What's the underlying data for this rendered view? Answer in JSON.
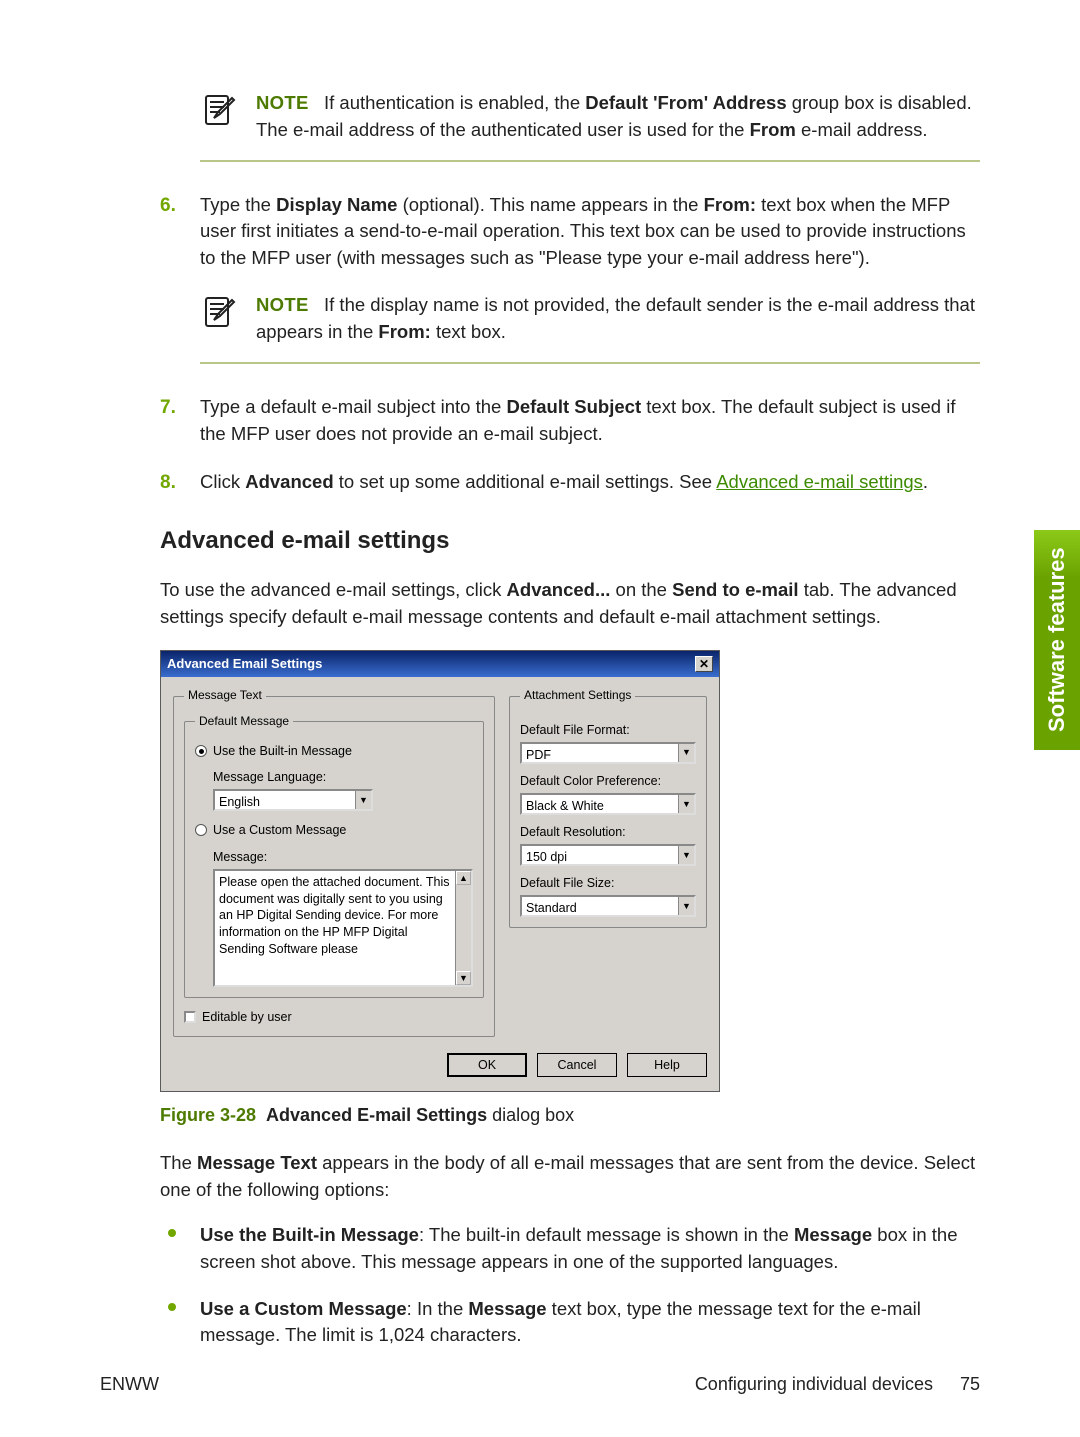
{
  "notes": {
    "label": "NOTE",
    "note1_a": "If authentication is enabled, the ",
    "note1_b": "Default 'From' Address",
    "note1_c": " group box is disabled. The e-mail address of the authenticated user is used for the ",
    "note1_d": "From",
    "note1_e": " e-mail address.",
    "note2_a": "If the display name is not provided, the default sender is the e-mail address that appears in the ",
    "note2_b": "From:",
    "note2_c": " text box."
  },
  "steps": {
    "s6": {
      "num": "6.",
      "a": "Type the ",
      "b": "Display Name",
      "c": " (optional). This name appears in the ",
      "d": "From:",
      "e": " text box when the MFP user first initiates a send-to-e-mail operation. This text box can be used to provide instructions to the MFP user (with messages such as \"Please type your e-mail address here\")."
    },
    "s7": {
      "num": "7.",
      "a": "Type a default e-mail subject into the ",
      "b": "Default Subject",
      "c": " text box. The default subject is used if the MFP user does not provide an e-mail subject."
    },
    "s8": {
      "num": "8.",
      "a": "Click ",
      "b": "Advanced",
      "c": " to set up some additional e-mail settings. See ",
      "link": "Advanced e-mail settings",
      "d": "."
    }
  },
  "section": {
    "title": "Advanced e-mail settings",
    "intro_a": "To use the advanced e-mail settings, click ",
    "intro_b": "Advanced...",
    "intro_c": " on the ",
    "intro_d": "Send to e-mail",
    "intro_e": " tab. The advanced settings specify default e-mail message contents and default e-mail attachment settings."
  },
  "dialog": {
    "title": "Advanced Email Settings",
    "msgtext_legend": "Message Text",
    "defmsg_legend": "Default Message",
    "radio_builtin": "Use the Built-in Message",
    "lang_label": "Message Language:",
    "lang_value": "English",
    "radio_custom": "Use a Custom Message",
    "msg_label": "Message:",
    "msg_value": "Please open the attached document. This document was digitally sent to you using an HP Digital Sending device.\n\nFor more information on the HP MFP Digital Sending Software please",
    "editable": "Editable by user",
    "attach_legend": "Attachment Settings",
    "fmt_label": "Default File Format:",
    "fmt_value": "PDF",
    "color_label": "Default Color Preference:",
    "color_value": "Black & White",
    "res_label": "Default Resolution:",
    "res_value": "150 dpi",
    "size_label": "Default File Size:",
    "size_value": "Standard",
    "ok": "OK",
    "cancel": "Cancel",
    "help": "Help"
  },
  "figure": {
    "label": "Figure 3-28",
    "title": "Advanced E-mail Settings",
    "suffix": " dialog box"
  },
  "body_after": {
    "p1_a": "The ",
    "p1_b": "Message Text",
    "p1_c": " appears in the body of all e-mail messages that are sent from the device. Select one of the following options:",
    "b1_a": "Use the Built-in Message",
    "b1_b": ": The built-in default message is shown in the ",
    "b1_c": "Message",
    "b1_d": " box in the screen shot above. This message appears in one of the supported languages.",
    "b2_a": "Use a Custom Message",
    "b2_b": ": In the ",
    "b2_c": "Message",
    "b2_d": " text box, type the message text for the e-mail message. The limit is 1,024 characters."
  },
  "sidetab": "Software features",
  "footer": {
    "left": "ENWW",
    "right": "Configuring individual devices",
    "page": "75"
  }
}
